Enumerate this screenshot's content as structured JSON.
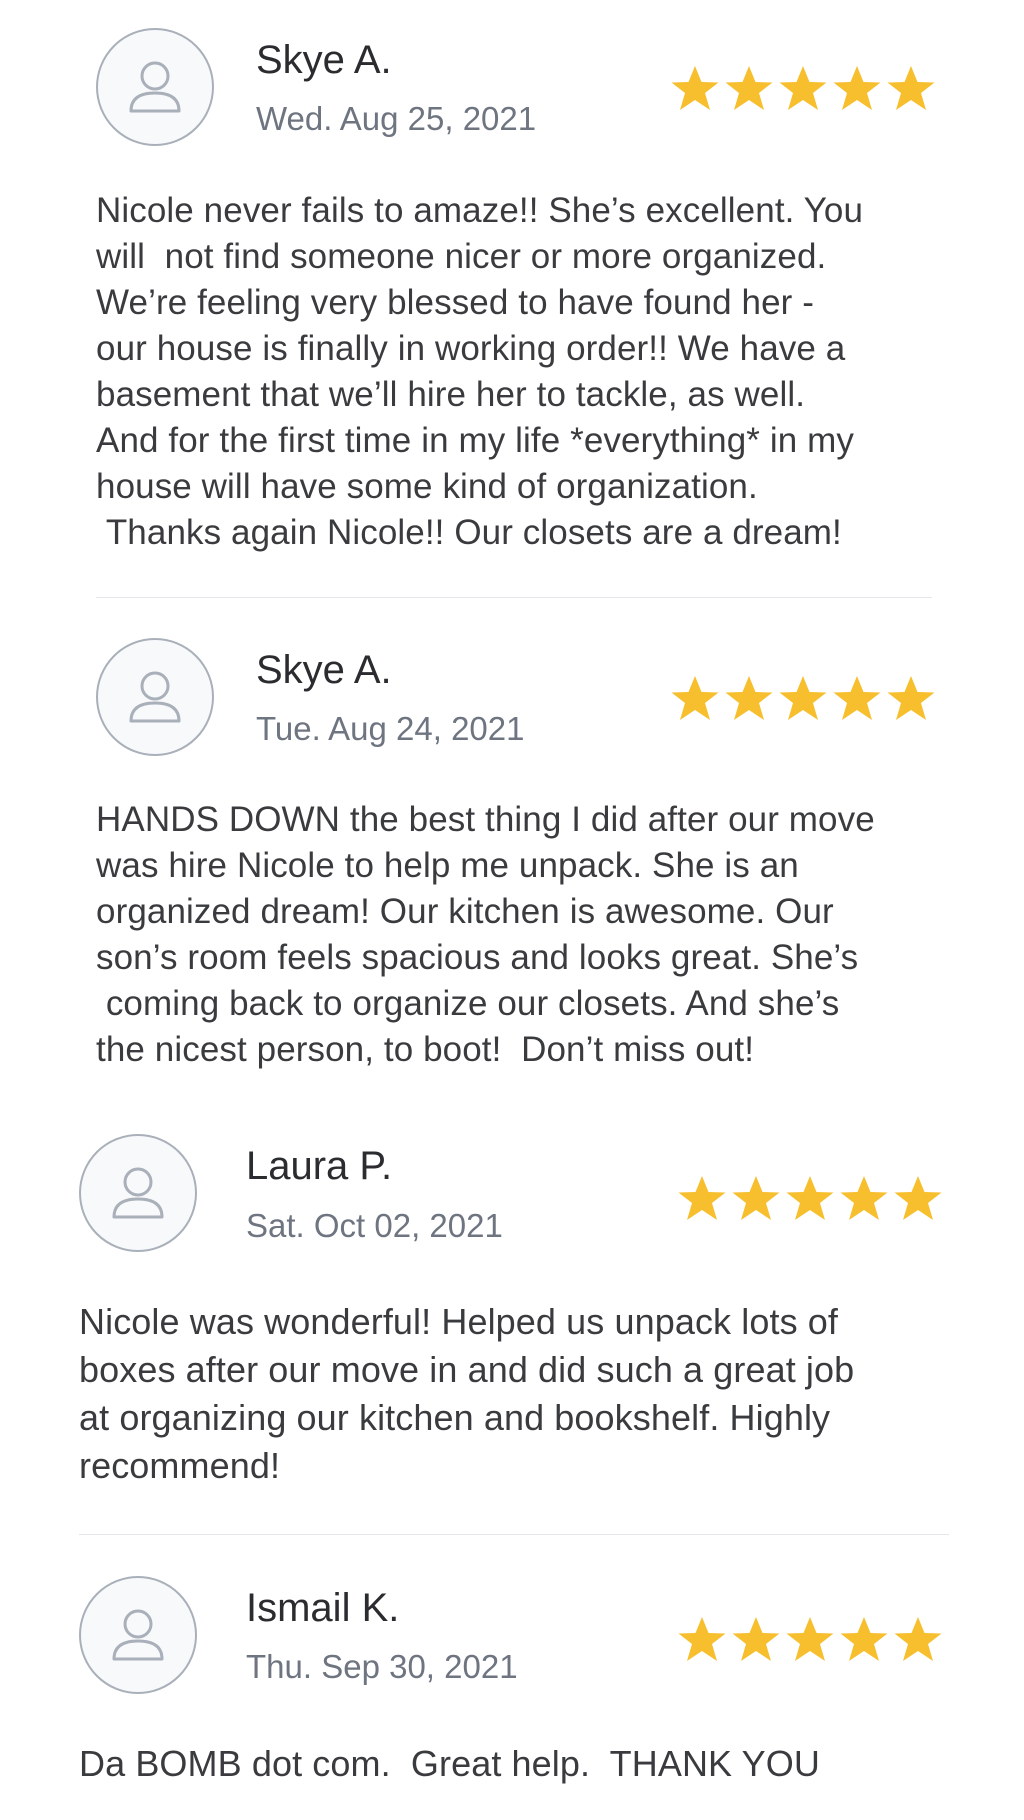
{
  "star_color": "#f7bf2e",
  "reviews": [
    {
      "author": "Skye A.",
      "date": "Wed. Aug 25, 2021",
      "rating": 5,
      "avatar_icon": "user-icon",
      "text": "Nicole never fails to amaze!! She’s excellent. You\nwill  not find someone nicer or more organized.\nWe’re feeling very blessed to have found her -\nour house is finally in working order!! We have a\nbasement that we’ll hire her to tackle, as well.\nAnd for the first time in my life *everything* in my\nhouse will have some kind of organization.\n Thanks again Nicole!! Our closets are a dream!"
    },
    {
      "author": "Skye A.",
      "date": "Tue. Aug 24, 2021",
      "rating": 5,
      "avatar_icon": "user-icon",
      "text": "HANDS DOWN the best thing I did after our move\nwas hire Nicole to help me unpack. She is an\norganized dream! Our kitchen is awesome. Our\nson’s room feels spacious and looks great. She’s\n coming back to organize our closets. And she’s\nthe nicest person, to boot!  Don’t miss out!"
    },
    {
      "author": "Laura P.",
      "date": "Sat. Oct 02, 2021",
      "rating": 5,
      "avatar_icon": "user-icon",
      "text": "Nicole was wonderful! Helped us unpack lots of\nboxes after our move in and did such a great job\nat organizing our kitchen and bookshelf. Highly\nrecommend!"
    },
    {
      "author": "Ismail K.",
      "date": "Thu. Sep 30, 2021",
      "rating": 5,
      "avatar_icon": "user-icon",
      "text": "Da BOMB dot com.  Great help.  THANK YOU"
    }
  ]
}
